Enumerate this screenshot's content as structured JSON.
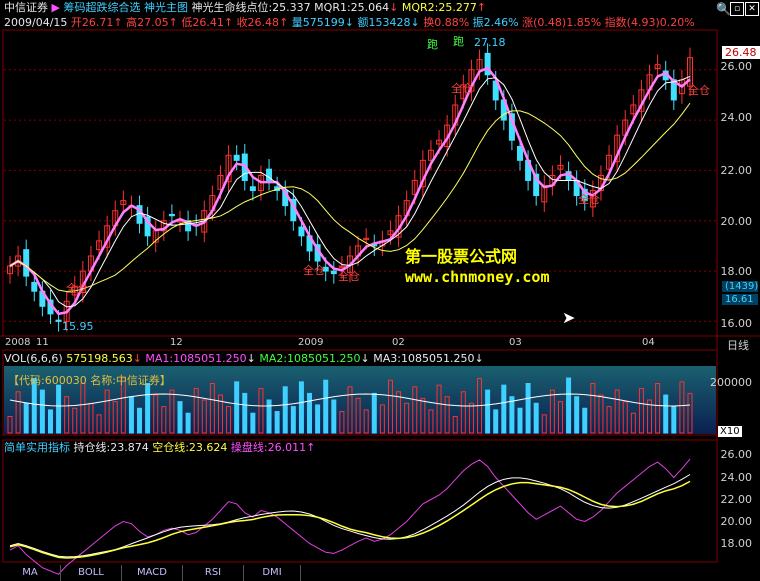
{
  "header": {
    "stock_name": "中信证券",
    "indicator_1": "筹码超跌综合选",
    "indicator_2": "神光主图",
    "line_label": "神光生命线点位:25.337",
    "mqr1": "MQR1:25.064",
    "mqr2": "MQR2:25.277",
    "date": "2009/04/15",
    "open": "开26.71",
    "high": "高27.05",
    "low": "低26.41",
    "close": "收26.48",
    "volume": "量575199",
    "amount": "额153428",
    "turnover": "换0.88%",
    "amplitude": "振2.46%",
    "change": "涨(0.48)1.85%",
    "index": "指数(4.93)0.20%"
  },
  "main_axis": {
    "ticks": [
      "26.00",
      "24.00",
      "22.00",
      "20.00",
      "18.00",
      "16.00"
    ],
    "current_price": "26.48",
    "side_box_1": "(1439)",
    "side_box_2": "16.61"
  },
  "time_axis": {
    "labels": [
      "2008",
      "11",
      "12",
      "2009",
      "02",
      "03",
      "04"
    ],
    "period": "日线"
  },
  "annotations": {
    "low_label": "15.95",
    "high_label": "27.18",
    "run_1": "跑",
    "run_2": "跑",
    "full_pos": "全仓",
    "watermark_title": "第一股票公式网",
    "watermark_url": "www.chnmoney.com"
  },
  "volume_panel": {
    "title": "VOL(6,6,6)",
    "vol": "575198.563",
    "ma1": "MA1:1085051.250",
    "ma2": "MA2:1085051.250",
    "ma3": "MA3:1085051.250",
    "overlay": "【代码:600030 名称:中信证券】",
    "axis_label": "200000",
    "unit": "X10"
  },
  "indicator_panel": {
    "title": "简单实用指标",
    "hold": "持仓线:23.874",
    "empty": "空仓线:23.624",
    "operate": "操盘线:26.011",
    "ticks": [
      "26.00",
      "24.00",
      "22.00",
      "20.00",
      "18.00"
    ]
  },
  "buttons": [
    "MA",
    "BOLL",
    "MACD",
    "RSI",
    "DMI"
  ],
  "colors": {
    "up": "#ff3030",
    "down": "#40e0ff",
    "ma_white": "#ffffff",
    "ma_yellow": "#ffff60",
    "ma_pink": "#ff80ff",
    "grid": "#800000"
  },
  "chart_data": {
    "type": "candlestick",
    "x": [
      "2008/11",
      "2008/12",
      "2009/01",
      "2009/02",
      "2009/03",
      "2009/04"
    ],
    "ylim": [
      15.5,
      27.5
    ],
    "closes": [
      18.2,
      18.6,
      17.8,
      17.2,
      16.6,
      16.3,
      16.0,
      16.8,
      17.4,
      18.0,
      18.6,
      19.2,
      19.8,
      20.4,
      20.8,
      20.6,
      19.9,
      19.4,
      19.6,
      20.0,
      20.2,
      20.0,
      19.6,
      19.8,
      20.4,
      21.0,
      21.8,
      22.6,
      22.4,
      21.6,
      21.2,
      21.8,
      21.6,
      21.2,
      20.6,
      20.0,
      19.4,
      18.8,
      18.4,
      18.0,
      17.9,
      18.2,
      18.6,
      19.0,
      19.3,
      19.0,
      19.2,
      19.6,
      20.2,
      20.8,
      21.6,
      22.4,
      22.8,
      23.2,
      23.8,
      24.6,
      25.4,
      26.0,
      26.4,
      25.8,
      24.8,
      24.0,
      23.2,
      22.4,
      21.6,
      21.0,
      21.4,
      21.8,
      22.2,
      21.6,
      21.0,
      20.8,
      21.2,
      21.8,
      22.6,
      23.4,
      24.0,
      24.6,
      25.2,
      25.8,
      26.2,
      25.6,
      24.8,
      25.6,
      26.48
    ],
    "volume_max": 300000
  }
}
